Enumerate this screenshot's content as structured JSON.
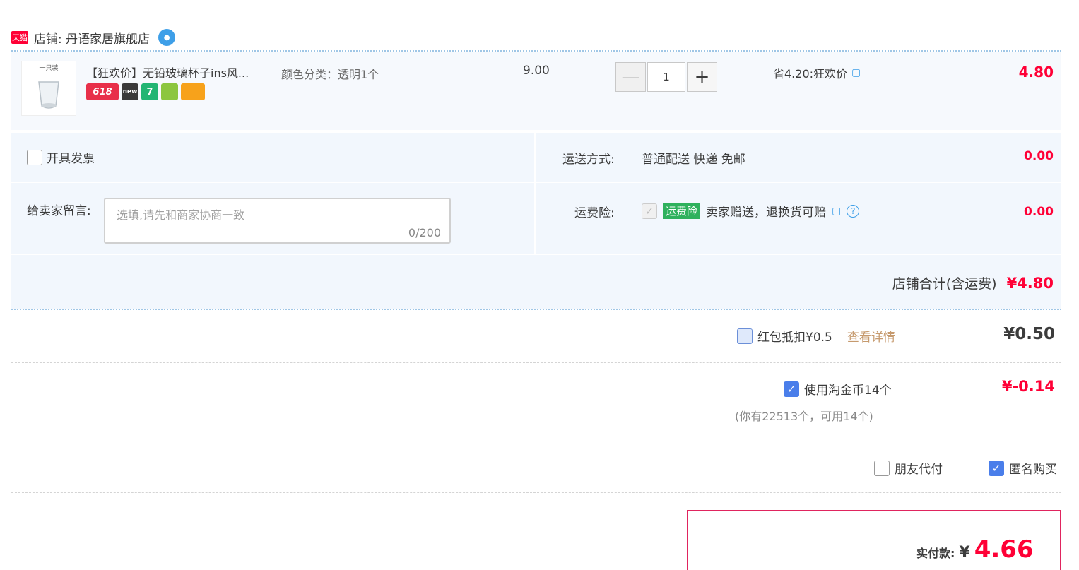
{
  "shop": {
    "badge": "天猫",
    "label": "店铺: 丹语家居旗舰店"
  },
  "item": {
    "thumb_caption": "一只装",
    "title": "【狂欢价】无铅玻璃杯子ins风...",
    "spec": "颜色分类：透明1个",
    "badges": [
      "618",
      "new",
      "7",
      "",
      ""
    ],
    "unit_price": "9.00",
    "qty": "1",
    "qty_minus": "—",
    "qty_plus": "+",
    "promo": "省4.20:狂欢价",
    "total": "4.80"
  },
  "invoice": {
    "label": "开具发票"
  },
  "shipping": {
    "label": "运送方式:",
    "value": "普通配送 快递 免邮",
    "price": "0.00"
  },
  "message": {
    "label": "给卖家留言:",
    "placeholder": "选填,请先和商家协商一致",
    "counter": "0/200"
  },
  "insurance": {
    "label": "运费险:",
    "tag": "运费险",
    "desc": "卖家赠送，退换货可赔",
    "price": "0.00"
  },
  "shop_total": {
    "label": "店铺合计(含运费)",
    "value": "¥4.80"
  },
  "redpacket": {
    "label": "红包抵扣¥0.5",
    "link": "查看详情",
    "value": "¥0.50"
  },
  "coins": {
    "label": "使用淘金币14个",
    "note": "(你有22513个，可用14个)",
    "value": "¥-0.14"
  },
  "friend_pay": {
    "label": "朋友代付"
  },
  "anonymous": {
    "label": "匿名购买"
  },
  "final": {
    "label": "实付款:",
    "currency": "¥",
    "value": "4.66"
  }
}
